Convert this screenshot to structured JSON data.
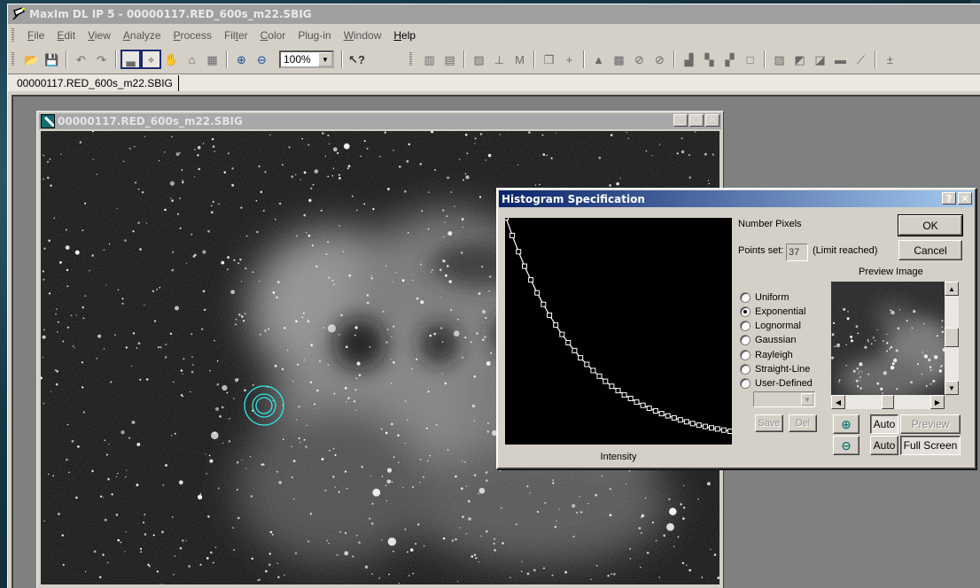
{
  "app": {
    "title": "MaxIm DL IP 5 - 00000117.RED_600s_m22.SBIG",
    "menu": [
      {
        "label": "File",
        "underline": "F",
        "active": false
      },
      {
        "label": "Edit",
        "underline": "E",
        "active": false
      },
      {
        "label": "View",
        "underline": "V",
        "active": false
      },
      {
        "label": "Analyze",
        "underline": "A",
        "active": false
      },
      {
        "label": "Process",
        "underline": "P",
        "active": false
      },
      {
        "label": "Filter",
        "underline": "t",
        "active": false
      },
      {
        "label": "Color",
        "underline": "C",
        "active": false
      },
      {
        "label": "Plug-in",
        "underline": "g",
        "active": false
      },
      {
        "label": "Window",
        "underline": "W",
        "active": false
      },
      {
        "label": "Help",
        "underline": "H",
        "active": true
      }
    ],
    "toolbar": {
      "left_buttons": [
        {
          "name": "open-icon",
          "glyph": "📂"
        },
        {
          "name": "save-icon",
          "glyph": "💾"
        },
        {
          "sep": true
        },
        {
          "name": "undo-icon",
          "glyph": "↶"
        },
        {
          "name": "redo-icon",
          "glyph": "↷"
        },
        {
          "sep": true
        },
        {
          "name": "screen-stretch-icon",
          "glyph": "▃",
          "pressed": true
        },
        {
          "name": "crosshair-icon",
          "glyph": "⌖",
          "pressed": true
        },
        {
          "name": "pan-icon",
          "glyph": "✋"
        },
        {
          "name": "lock-icon",
          "glyph": "⌂"
        },
        {
          "name": "settings-icon",
          "glyph": "▦"
        },
        {
          "sep": true
        },
        {
          "name": "zoom-in-icon",
          "glyph": "⊕",
          "blue": true
        },
        {
          "name": "zoom-out-icon",
          "glyph": "⊖",
          "blue": true
        }
      ],
      "zoom_value": "100%",
      "help_glyph": "↖?",
      "right_buttons": [
        {
          "name": "histogram-icon",
          "glyph": "▥"
        },
        {
          "name": "stack-icon",
          "glyph": "▤"
        },
        {
          "sep": true
        },
        {
          "name": "calibrate-icon",
          "glyph": "▧"
        },
        {
          "name": "align-icon",
          "glyph": "⊥"
        },
        {
          "name": "measure-icon",
          "glyph": "M"
        },
        {
          "sep": true
        },
        {
          "name": "copy-icon",
          "glyph": "❐"
        },
        {
          "name": "add-icon",
          "glyph": "+"
        },
        {
          "sep": true
        },
        {
          "name": "thermometer-icon",
          "glyph": "▲"
        },
        {
          "name": "noise-icon",
          "glyph": "▩"
        },
        {
          "name": "filter-circle-icon",
          "glyph": "⊘"
        },
        {
          "name": "filter-circle2-icon",
          "glyph": "⊘"
        },
        {
          "sep": true
        },
        {
          "name": "bar-chart-icon",
          "glyph": "▟"
        },
        {
          "name": "overlap-icon",
          "glyph": "▚"
        },
        {
          "name": "layers-icon",
          "glyph": "▞"
        },
        {
          "name": "square-icon",
          "glyph": "□"
        },
        {
          "sep": true
        },
        {
          "name": "gradient1-icon",
          "glyph": "▨"
        },
        {
          "name": "gradient2-icon",
          "glyph": "◩"
        },
        {
          "name": "gradient3-icon",
          "glyph": "◪"
        },
        {
          "name": "bar-icon",
          "glyph": "▬"
        },
        {
          "name": "curve-icon",
          "glyph": "⟋"
        },
        {
          "sep": true
        },
        {
          "name": "pixel-math-icon",
          "glyph": "±"
        }
      ]
    },
    "doc_tab": "00000117.RED_600s_m22.SBIG"
  },
  "image_window": {
    "title": "00000117.RED_600s_m22.SBIG",
    "buttons": {
      "minimize": "_",
      "maximize": "□",
      "close": "✕"
    }
  },
  "dialog": {
    "title": "Histogram Specification",
    "help_button": "?",
    "close_button": "✕",
    "number_pixels_label": "Number Pixels",
    "points_set_label": "Points set:",
    "points_set_value": "37",
    "limit_text": "(Limit reached)",
    "ok_label": "OK",
    "cancel_label": "Cancel",
    "preview_label": "Preview Image",
    "distributions": [
      {
        "label": "Uniform",
        "checked": false
      },
      {
        "label": "Exponential",
        "checked": true
      },
      {
        "label": "Lognormal",
        "checked": false
      },
      {
        "label": "Gaussian",
        "checked": false
      },
      {
        "label": "Rayleigh",
        "checked": false
      },
      {
        "label": "Straight-Line",
        "checked": false
      },
      {
        "label": "User-Defined",
        "checked": false
      }
    ],
    "user_defined_select": "",
    "save_label": "Save",
    "del_label": "Del",
    "auto_label_1": "Auto",
    "preview_button": "Preview",
    "auto_label_2": "Auto",
    "full_screen_button": "Full Screen"
  },
  "chart_data": {
    "type": "line",
    "title": "",
    "xlabel": "Intensity",
    "ylabel": "Number Pixels",
    "xlim": [
      0,
      1
    ],
    "ylim": [
      0,
      1
    ],
    "grid": false,
    "legend": "none",
    "series": [
      {
        "name": "Exponential",
        "x": [
          0.0,
          0.028,
          0.056,
          0.083,
          0.111,
          0.139,
          0.167,
          0.194,
          0.222,
          0.25,
          0.278,
          0.306,
          0.333,
          0.361,
          0.389,
          0.417,
          0.444,
          0.472,
          0.5,
          0.528,
          0.556,
          0.583,
          0.611,
          0.639,
          0.667,
          0.694,
          0.722,
          0.75,
          0.778,
          0.806,
          0.833,
          0.861,
          0.889,
          0.917,
          0.944,
          0.972,
          1.0
        ],
        "y": [
          1.0,
          0.922,
          0.85,
          0.786,
          0.725,
          0.668,
          0.617,
          0.569,
          0.525,
          0.484,
          0.447,
          0.412,
          0.38,
          0.351,
          0.324,
          0.299,
          0.276,
          0.254,
          0.235,
          0.216,
          0.2,
          0.184,
          0.17,
          0.157,
          0.145,
          0.133,
          0.123,
          0.114,
          0.105,
          0.097,
          0.089,
          0.082,
          0.076,
          0.07,
          0.065,
          0.06,
          0.055
        ]
      }
    ]
  }
}
